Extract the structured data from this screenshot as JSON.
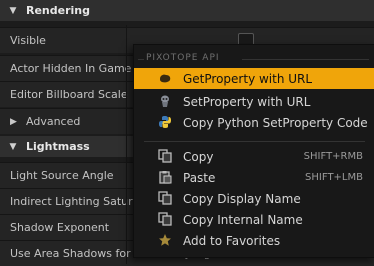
{
  "details": {
    "rendering_header": "Rendering",
    "rows_top": [
      {
        "label": "Visible"
      },
      {
        "label": "Actor Hidden In Game"
      },
      {
        "label": "Editor Billboard Scale"
      },
      {
        "label": "Advanced"
      }
    ],
    "lightmass_header": "Lightmass",
    "rows_bottom": [
      {
        "label": "Light Source Angle"
      },
      {
        "label": "Indirect Lighting Saturati"
      },
      {
        "label": "Shadow Exponent"
      },
      {
        "label": "Use Area Shadows for Stationary Light"
      }
    ]
  },
  "context_menu": {
    "section_title": "PIXOTOPE API",
    "api_items": [
      {
        "label": "GetProperty with URL",
        "icon": "pixotope-get-icon",
        "highlighted": true
      },
      {
        "label": "SetProperty with URL",
        "icon": "pixotope-set-icon"
      },
      {
        "label": "Copy Python SetProperty Code",
        "icon": "python-icon"
      }
    ],
    "edit_items": [
      {
        "label": "Copy",
        "shortcut": "SHIFT+RMB",
        "icon": "copy-icon"
      },
      {
        "label": "Paste",
        "shortcut": "SHIFT+LMB",
        "icon": "paste-icon"
      },
      {
        "label": "Copy Display Name",
        "icon": "copy-icon"
      },
      {
        "label": "Copy Internal Name",
        "icon": "copy-icon"
      },
      {
        "label": "Add to Favorites",
        "icon": "star-icon"
      }
    ]
  }
}
